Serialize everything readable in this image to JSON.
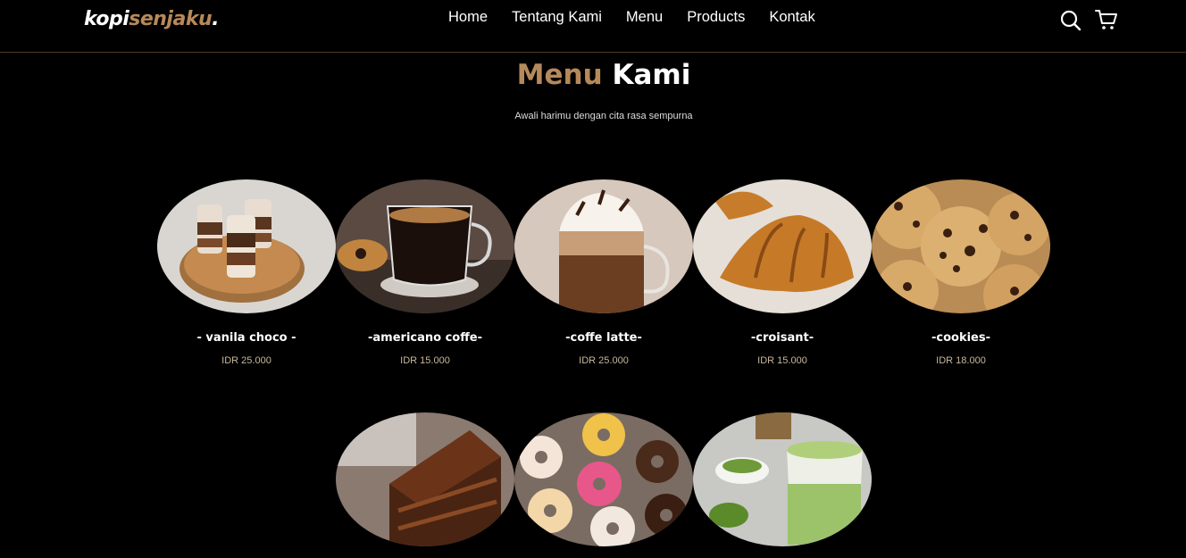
{
  "brand": {
    "part1": "kopi",
    "part2": "senjaku",
    "dot": "."
  },
  "nav": {
    "links": [
      "Home",
      "Tentang Kami",
      "Menu",
      "Products",
      "Kontak"
    ],
    "icons": [
      "search-icon",
      "cart-icon"
    ]
  },
  "section": {
    "title_accent": "Menu",
    "title_main": "Kami",
    "subtitle": "Awali harimu dengan cita rasa sempurna"
  },
  "menu": [
    {
      "name": "- vanila choco -",
      "price": "IDR 25.000",
      "image": "vanila-choco-image"
    },
    {
      "name": "-americano coffe-",
      "price": "IDR 15.000",
      "image": "americano-image"
    },
    {
      "name": "-coffe latte-",
      "price": "IDR 25.000",
      "image": "coffe-latte-image"
    },
    {
      "name": "-croisant-",
      "price": "IDR 15.000",
      "image": "croisant-image"
    },
    {
      "name": "-cookies-",
      "price": "IDR 18.000",
      "image": "cookies-image"
    },
    {
      "image": "chocolate-cake-image"
    },
    {
      "image": "donuts-image"
    },
    {
      "image": "matcha-latte-image"
    }
  ],
  "colors": {
    "accent": "#b6895b",
    "background": "#000000",
    "text": "#ffffff"
  }
}
